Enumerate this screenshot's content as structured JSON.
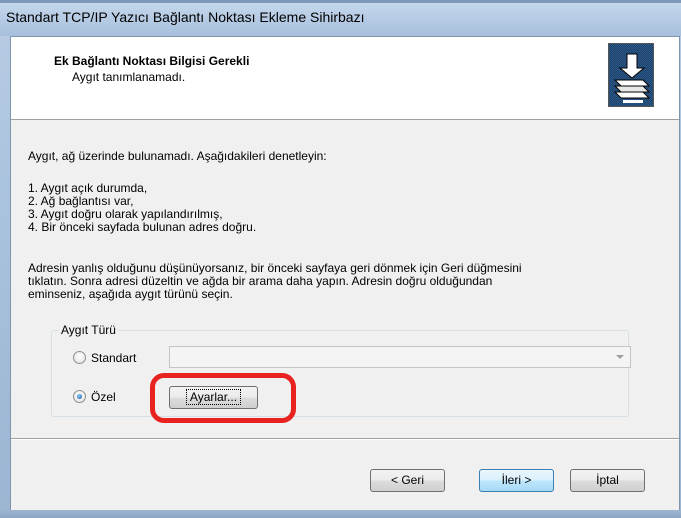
{
  "window": {
    "title": "Standart TCP/IP Yazıcı Bağlantı Noktası Ekleme Sihirbazı"
  },
  "header": {
    "title": "Ek Bağlantı Noktası Bilgisi Gerekli",
    "subtitle": "Aygıt tanımlanamadı."
  },
  "body": {
    "intro": "Aygıt, ağ üzerinde bulunamadı.  Aşağıdakileri denetleyin:",
    "checklist": [
      "1.  Aygıt açık durumda,",
      "2.  Ağ bağlantısı var,",
      "3.  Aygıt doğru olarak yapılandırılmış,",
      "4.  Bir önceki sayfada bulunan adres doğru."
    ],
    "paragraph": [
      "Adresin yanlış olduğunu düşünüyorsanız, bir önceki sayfaya geri dönmek için Geri düğmesini",
      "tıklatın. Sonra adresi düzeltin ve ağda bir arama daha yapın. Adresin doğru olduğundan",
      "eminseniz, aşağıda aygıt türünü seçin."
    ]
  },
  "device_type": {
    "legend": "Aygıt Türü",
    "standard_label": "Standart",
    "custom_label": "Özel",
    "selected": "Özel",
    "standard_combo_value": "",
    "settings_button": "Ayarlar..."
  },
  "footer": {
    "back": "< Geri",
    "next": "İleri >",
    "cancel": "İptal"
  },
  "colors": {
    "annotation_ring": "#e8231f",
    "default_button": "#3c7fb1"
  },
  "icons": {
    "header": "printer-wizard-icon"
  }
}
